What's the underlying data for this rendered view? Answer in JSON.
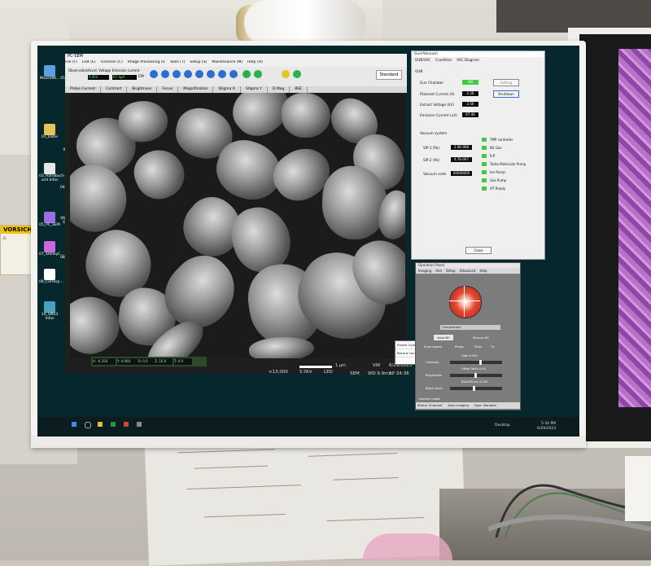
{
  "desktop_icons": [
    {
      "label": "MouseWi..."
    },
    {
      "label": "01_Recycle Bin"
    },
    {
      "label": "01_Datei"
    },
    {
      "label": "02_Scan 2D"
    },
    {
      "label": "03_Handbuch und Infos"
    },
    {
      "label": "04_VolGlassr..."
    },
    {
      "label": "05_PC_SEM"
    },
    {
      "label": "06_Dustest Detector"
    },
    {
      "label": "07_SmileyC..."
    },
    {
      "label": "08_Montage"
    },
    {
      "label": "09_Corresp..."
    },
    {
      "label": "10_SMS3 Infos"
    }
  ],
  "sem_window": {
    "title": "PC-SEM",
    "menus": [
      "File (F)",
      "Edit (E)",
      "Function (C)",
      "Image Processing (I)",
      "Tools (T)",
      "Setup (S)",
      "Maintenance (M)",
      "Help (H)"
    ],
    "toolbar_labels": {
      "obs_mode": "Observation",
      "accel": "Accel. Voltage",
      "emission": "Emission current",
      "accel_value": "5.0kV",
      "emission_value": "67.4µA",
      "standard": "Standard",
      "em": "EM"
    },
    "tabs": [
      "Probe Current",
      "Contrast",
      "Brightness",
      "Focus",
      "Magnification",
      "Stigma X",
      "Stigma Y",
      "D.Mag",
      "BSE"
    ],
    "status_segments": [
      "X: -0.250",
      "Y: 0.000",
      "R: 0.0",
      "Z: 10.0",
      "T: 0.0"
    ],
    "info": {
      "mag": "×13,000",
      "kv": "5.0kV",
      "detector": "LED",
      "mode": "SEM",
      "scale": "1 µm",
      "vw": "VW",
      "wd": "WD 9.9mm",
      "date": "6/29/2023",
      "time": "17:34:36"
    },
    "popup_menu": [
      "Freeze Control",
      "Record Control"
    ]
  },
  "gun_dialog": {
    "title": "Gun/Vacuum",
    "tabs": [
      "GUN/VAC",
      "Condition",
      "VAC Diagram"
    ],
    "section_gun": "GUN",
    "gun_chamber_label": "Gun Chamber",
    "gun_chamber_state": "ON",
    "filament_label": "Filament Current (A)",
    "filament_value": "2.26",
    "shutdown_btn": "Shutdown",
    "setting_btn": "Setting",
    "extract_label": "Extract Voltage (kV)",
    "extract_value": "2.50",
    "emission_label": "Emission Current (uA)",
    "emission_value": "67.46",
    "section_vac": "Vacuum system",
    "gauges": [
      {
        "label": "SIP-1 (Pa)",
        "value": "2.9E-008"
      },
      {
        "label": "SIP-2 (Pa)",
        "value": "4.7E-007"
      }
    ],
    "vacuum_code_label": "Vacuum code",
    "vacuum_code_value": "00000000",
    "vac_status": [
      "TMP controller",
      "N2 Gas",
      "R.P",
      "Turbo Molecular Pump",
      "Ion Pump",
      "Gas Pump",
      "HT Ready"
    ],
    "close_btn": "Close"
  },
  "imaging_panel": {
    "title": "Operation Panel",
    "menus": [
      "Imaging",
      "Aim",
      "Setup",
      "Advanced",
      "Help"
    ],
    "composition": "Composition",
    "auto_bc": "Auto BC",
    "manual_bc": "Manual BC",
    "scan_speed_label": "Scan speed",
    "scan_options": [
      "Photo",
      "Slow",
      "Tv"
    ],
    "gain_label": "Gain 8.040",
    "contrast_label": "Contrast",
    "brightness_label": "Brightness",
    "offset_label": "Offset Volts 0.04",
    "blacklevel_label": "Black level",
    "backoff_label": "BackOff mv 21.09",
    "normal_mode": "Normal mode",
    "status_text": "Status: Unlocked",
    "auto_imaging": "Auto: imaging",
    "type_text": "Type: Standard"
  },
  "taskbar": {
    "desktop_label": "Desktop",
    "clock_time": "5:34 PM",
    "clock_date": "6/29/2023"
  },
  "warning_sign": {
    "title": "VORSICHT"
  }
}
